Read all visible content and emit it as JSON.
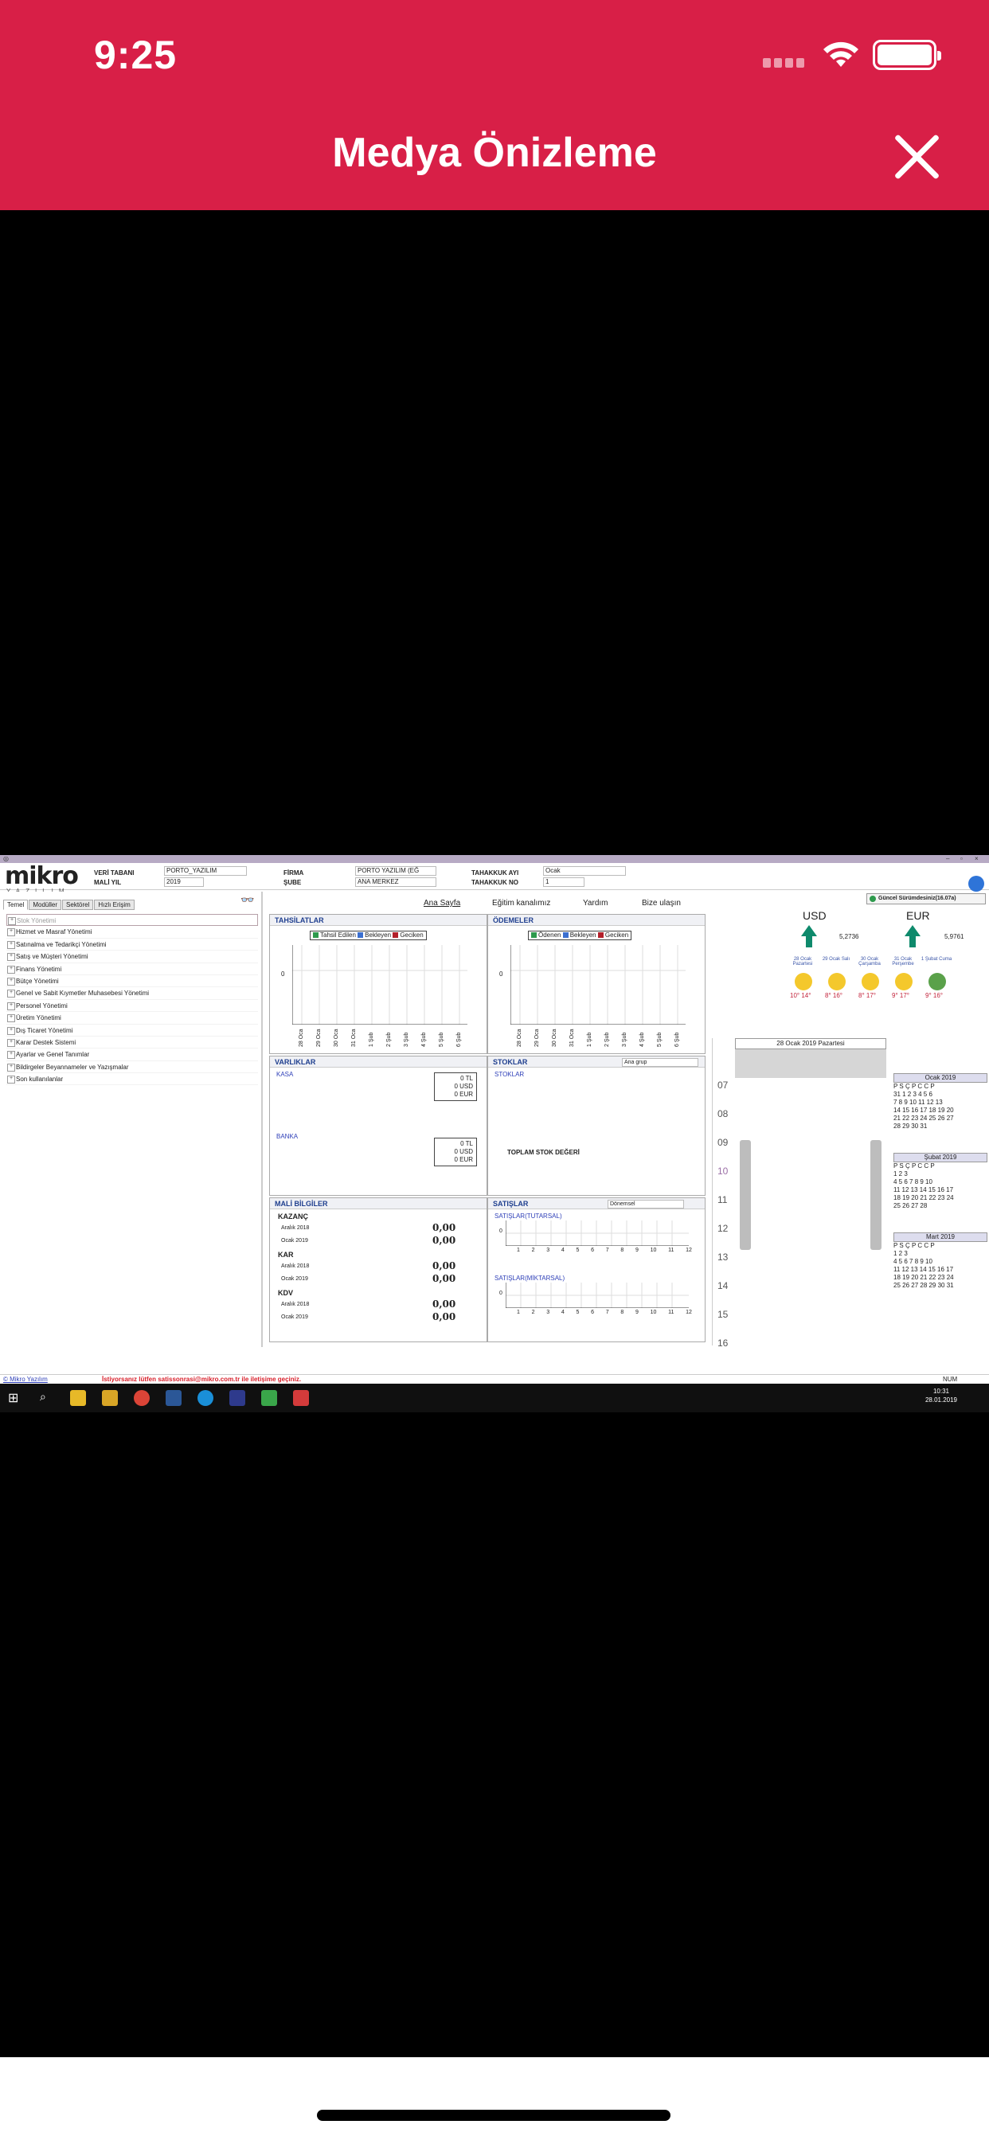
{
  "ios": {
    "time": "9:25",
    "title": "Medya Önizleme"
  },
  "app": {
    "logo_main": "mikro",
    "logo_sub": "YAZILIM",
    "header": {
      "veri_tabani_label": "VERİ TABANI",
      "veri_tabani_value": "PORTO_YAZILIM",
      "mali_yil_label": "MALİ YIL",
      "mali_yil_value": "2019",
      "firma_label": "FİRMA",
      "firma_value": "PORTO YAZILIM (EĞ",
      "sube_label": "ŞUBE",
      "sube_value": "ANA MERKEZ",
      "tahakkuk_ayi_label": "TAHAKKUK AYI",
      "tahakkuk_ayi_value": "Ocak",
      "tahakkuk_no_label": "TAHAKKUK NO",
      "tahakkuk_no_value": "1"
    },
    "tabs": [
      "Temel",
      "Modüller",
      "Sektörel",
      "Hızlı Erişim"
    ],
    "menu": [
      "Stok Yönetimi",
      "Hizmet ve Masraf Yönetimi",
      "Satınalma ve Tedarikçi Yönetimi",
      "Satış ve Müşteri Yönetimi",
      "Finans Yönetimi",
      "Bütçe Yönetimi",
      "Genel ve Sabit Kıymetler Muhasebesi Yönetimi",
      "Personel Yönetimi",
      "Üretim Yönetimi",
      "Dış Ticaret Yönetimi",
      "Karar Destek Sistemi",
      "Ayarlar ve Genel Tanımlar",
      "Bildirgeler Beyannameler ve Yazışmalar",
      "Son kullanılanlar"
    ],
    "nav": {
      "ana_sayfa": "Ana Sayfa",
      "egitim": "Eğitim kanalımız",
      "yardim": "Yardım",
      "bize_ulasin": "Bize ulaşın",
      "update": "Güncel Sürümdesiniz(16.07a)"
    },
    "tahsilatlar": {
      "title": "TAHSİLATLAR",
      "legend": [
        "Tahsil Edilen",
        "Bekleyen",
        "Geciken"
      ],
      "zero": "0",
      "dates": [
        "28 Oca",
        "29 Oca",
        "30 Oca",
        "31 Oca",
        "1 Şub",
        "2 Şub",
        "3 Şub",
        "4 Şub",
        "5 Şub",
        "6 Şub"
      ]
    },
    "odemeler": {
      "title": "ÖDEMELER",
      "legend": [
        "Ödenen",
        "Bekleyen",
        "Geciken"
      ],
      "zero": "0",
      "dates": [
        "28 Oca",
        "29 Oca",
        "30 Oca",
        "31 Oca",
        "1 Şub",
        "2 Şub",
        "3 Şub",
        "4 Şub",
        "5 Şub",
        "6 Şub"
      ]
    },
    "varliklar": {
      "title": "VARLIKLAR",
      "kasa": "KASA",
      "banka": "BANKA",
      "kasa_vals": [
        "0 TL",
        "0 USD",
        "0 EUR"
      ],
      "banka_vals": [
        "0 TL",
        "0 USD",
        "0 EUR"
      ]
    },
    "stoklar": {
      "title": "STOKLAR",
      "link": "STOKLAR",
      "dropdown": "Ana grup",
      "total": "TOPLAM STOK DEĞERİ"
    },
    "mali": {
      "title": "MALİ BİLGİLER",
      "kazanc": "KAZANÇ",
      "kar": "KAR",
      "kdv": "KDV",
      "aralik": "Aralık 2018",
      "ocak": "Ocak 2019",
      "value": "0,00"
    },
    "satislar": {
      "title": "SATIŞLAR",
      "dropdown": "Dönemsel",
      "tutarsal": "SATIŞLAR(TUTARSAL)",
      "miktarsal": "SATIŞLAR(MİKTARSAL)",
      "zero": "0",
      "months": [
        "1",
        "2",
        "3",
        "4",
        "5",
        "6",
        "7",
        "8",
        "9",
        "10",
        "11",
        "12"
      ]
    },
    "currency": {
      "usd_label": "USD",
      "usd_value": "5,2736",
      "eur_label": "EUR",
      "eur_value": "5,9761"
    },
    "weather": [
      {
        "day": "28 Ocak Pazartesi",
        "temp": "10° 14°"
      },
      {
        "day": "29 Ocak Salı",
        "temp": "8° 16°"
      },
      {
        "day": "30 Ocak Çarşamba",
        "temp": "8° 17°"
      },
      {
        "day": "31 Ocak Perşembe",
        "temp": "9° 17°"
      },
      {
        "day": "1 Şubat Cuma",
        "temp": "9° 16°"
      }
    ],
    "calendar": {
      "header": "28 Ocak 2019 Pazartesi",
      "hours": [
        "07",
        "08",
        "09",
        "10",
        "11",
        "12",
        "13",
        "14",
        "15",
        "16"
      ],
      "months": [
        "Ocak 2019",
        "Şubat 2019",
        "Mart 2019"
      ],
      "weekdays": "P S Ç P C C P"
    },
    "statusbar": {
      "link": "© Mikro Yazılım",
      "message": "İstiyorsanız lütfen satissonrasi@mikro.com.tr ile iletişime geçiniz.",
      "num": "NUM"
    },
    "taskbar": {
      "time": "10:31",
      "date": "28.01.2019"
    },
    "colors": {
      "ios_red": "#d81f47",
      "green_legend": "#2e9a4d",
      "blue_legend": "#3b6fd0",
      "red_legend": "#b3202a",
      "arrow_green": "#0e8a6c"
    }
  }
}
